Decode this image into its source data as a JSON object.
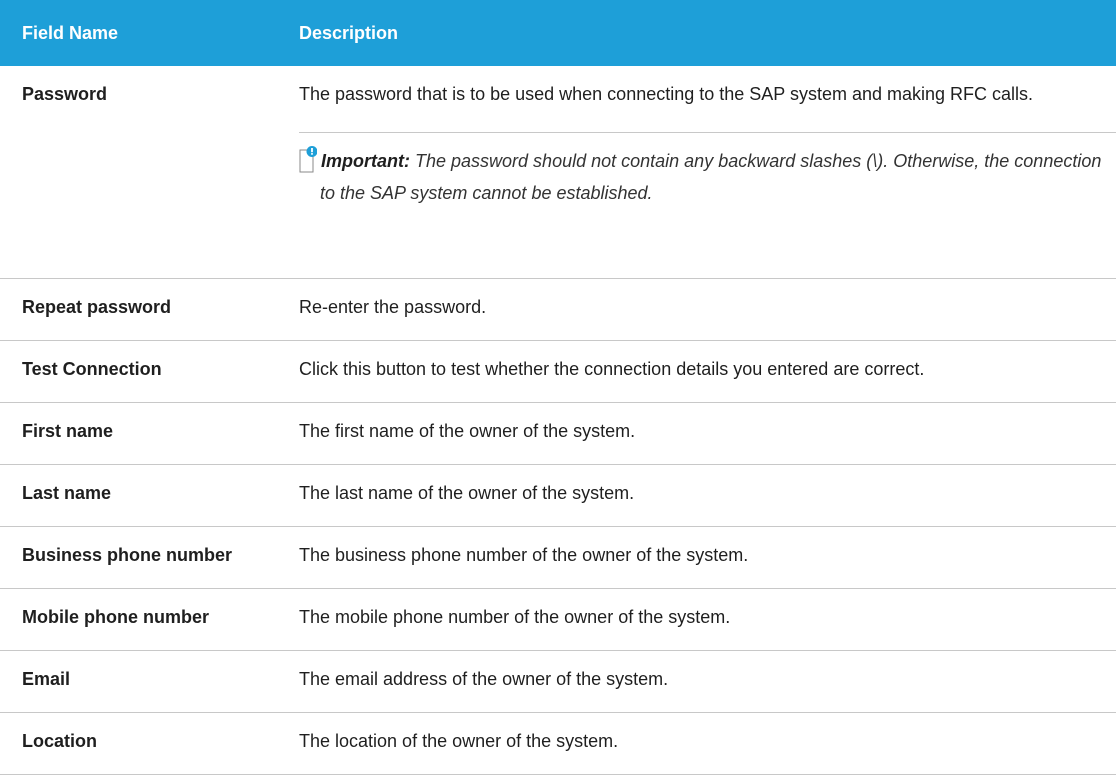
{
  "table": {
    "headers": {
      "field_name": "Field Name",
      "description": "Description"
    },
    "password": {
      "name": "Password",
      "desc": "The password that is to be used when connecting to the SAP system and making RFC calls.",
      "note_label": "Important:",
      "note_text": " The password should not contain any backward slashes (\\). Otherwise, the connection to the SAP system cannot be established.",
      "note_icon": "note-icon"
    },
    "rows": [
      {
        "name": "Repeat password",
        "desc": "Re-enter the password."
      },
      {
        "name": "Test Connection",
        "desc": "Click this button to test whether the connection details you entered are correct."
      },
      {
        "name": "First name",
        "desc": "The first name of the owner of the system."
      },
      {
        "name": "Last name",
        "desc": "The last name of the owner of the system."
      },
      {
        "name": "Business phone number",
        "desc": "The business phone number of the owner of the system."
      },
      {
        "name": "Mobile phone number",
        "desc": "The mobile phone number of the owner of the system."
      },
      {
        "name": "Email",
        "desc": "The email address of the owner of the system."
      },
      {
        "name": "Location",
        "desc": "The location of the owner of the system."
      }
    ]
  },
  "colors": {
    "header_bg": "#1e9fd8",
    "header_text": "#ffffff",
    "note_icon_accent": "#1e9fd8",
    "rule": "#c8c8c8"
  }
}
